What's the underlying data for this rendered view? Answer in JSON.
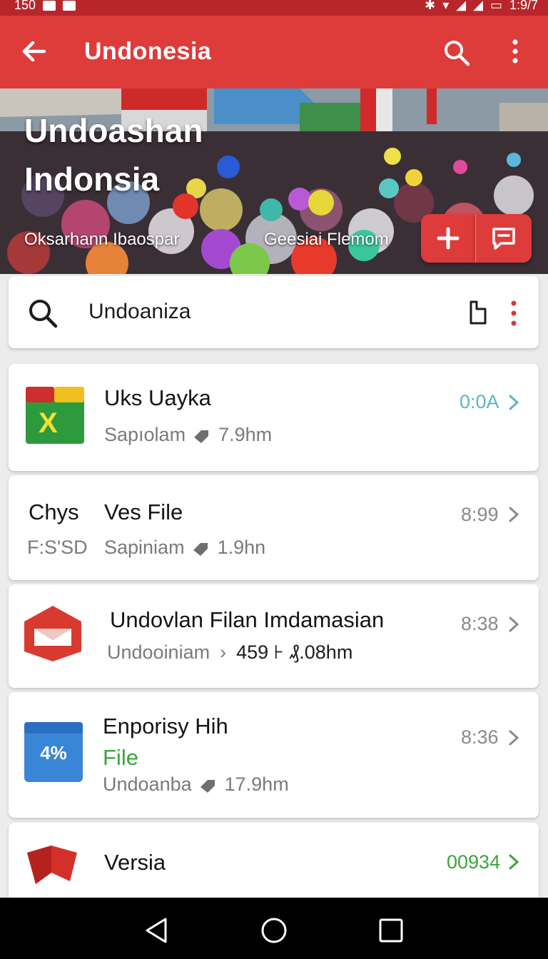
{
  "status_bar": {
    "time_left": "150",
    "time_right": "1:9/7"
  },
  "app_bar": {
    "title": "Undonesia"
  },
  "hero": {
    "title_line1": "Undoashan",
    "title_line2": "Indonsia",
    "caption_left": "Oksarhann Ibaospar",
    "caption_right": "Geesiai Flemom"
  },
  "search": {
    "value": "Undoaniza"
  },
  "items": [
    {
      "title": "Uks Uayka",
      "sub": "Sapıolam",
      "size": "7.9hm",
      "value": "0:0A",
      "value_color": "#5fb3c8"
    },
    {
      "prefix": "Chys",
      "prefix_sub": "F:S'SD",
      "title": "Ves File",
      "sub": "Sapiniam",
      "size": "1.9hn",
      "value": "8:99",
      "value_color": "#8a8a8a"
    },
    {
      "title": "Undovlan Filan Imdamasian",
      "sub": "Undooiniam",
      "size": "459 ⊦ ₰.08hm",
      "value": "8:38",
      "value_color": "#8a8a8a"
    },
    {
      "title": "Enporisy Hih",
      "title2": "File",
      "sub": "Undoanba",
      "size": "17.9hm",
      "value": "8:36",
      "value_color": "#8a8a8a",
      "icon_label": "4%"
    },
    {
      "title": "Versia",
      "value": "00934",
      "value_color": "#3aa63a"
    }
  ],
  "colors": {
    "primary": "#de3b3b",
    "status_bar": "#b8262b",
    "accent_green": "#3aa63a",
    "accent_teal": "#5fb3c8"
  }
}
